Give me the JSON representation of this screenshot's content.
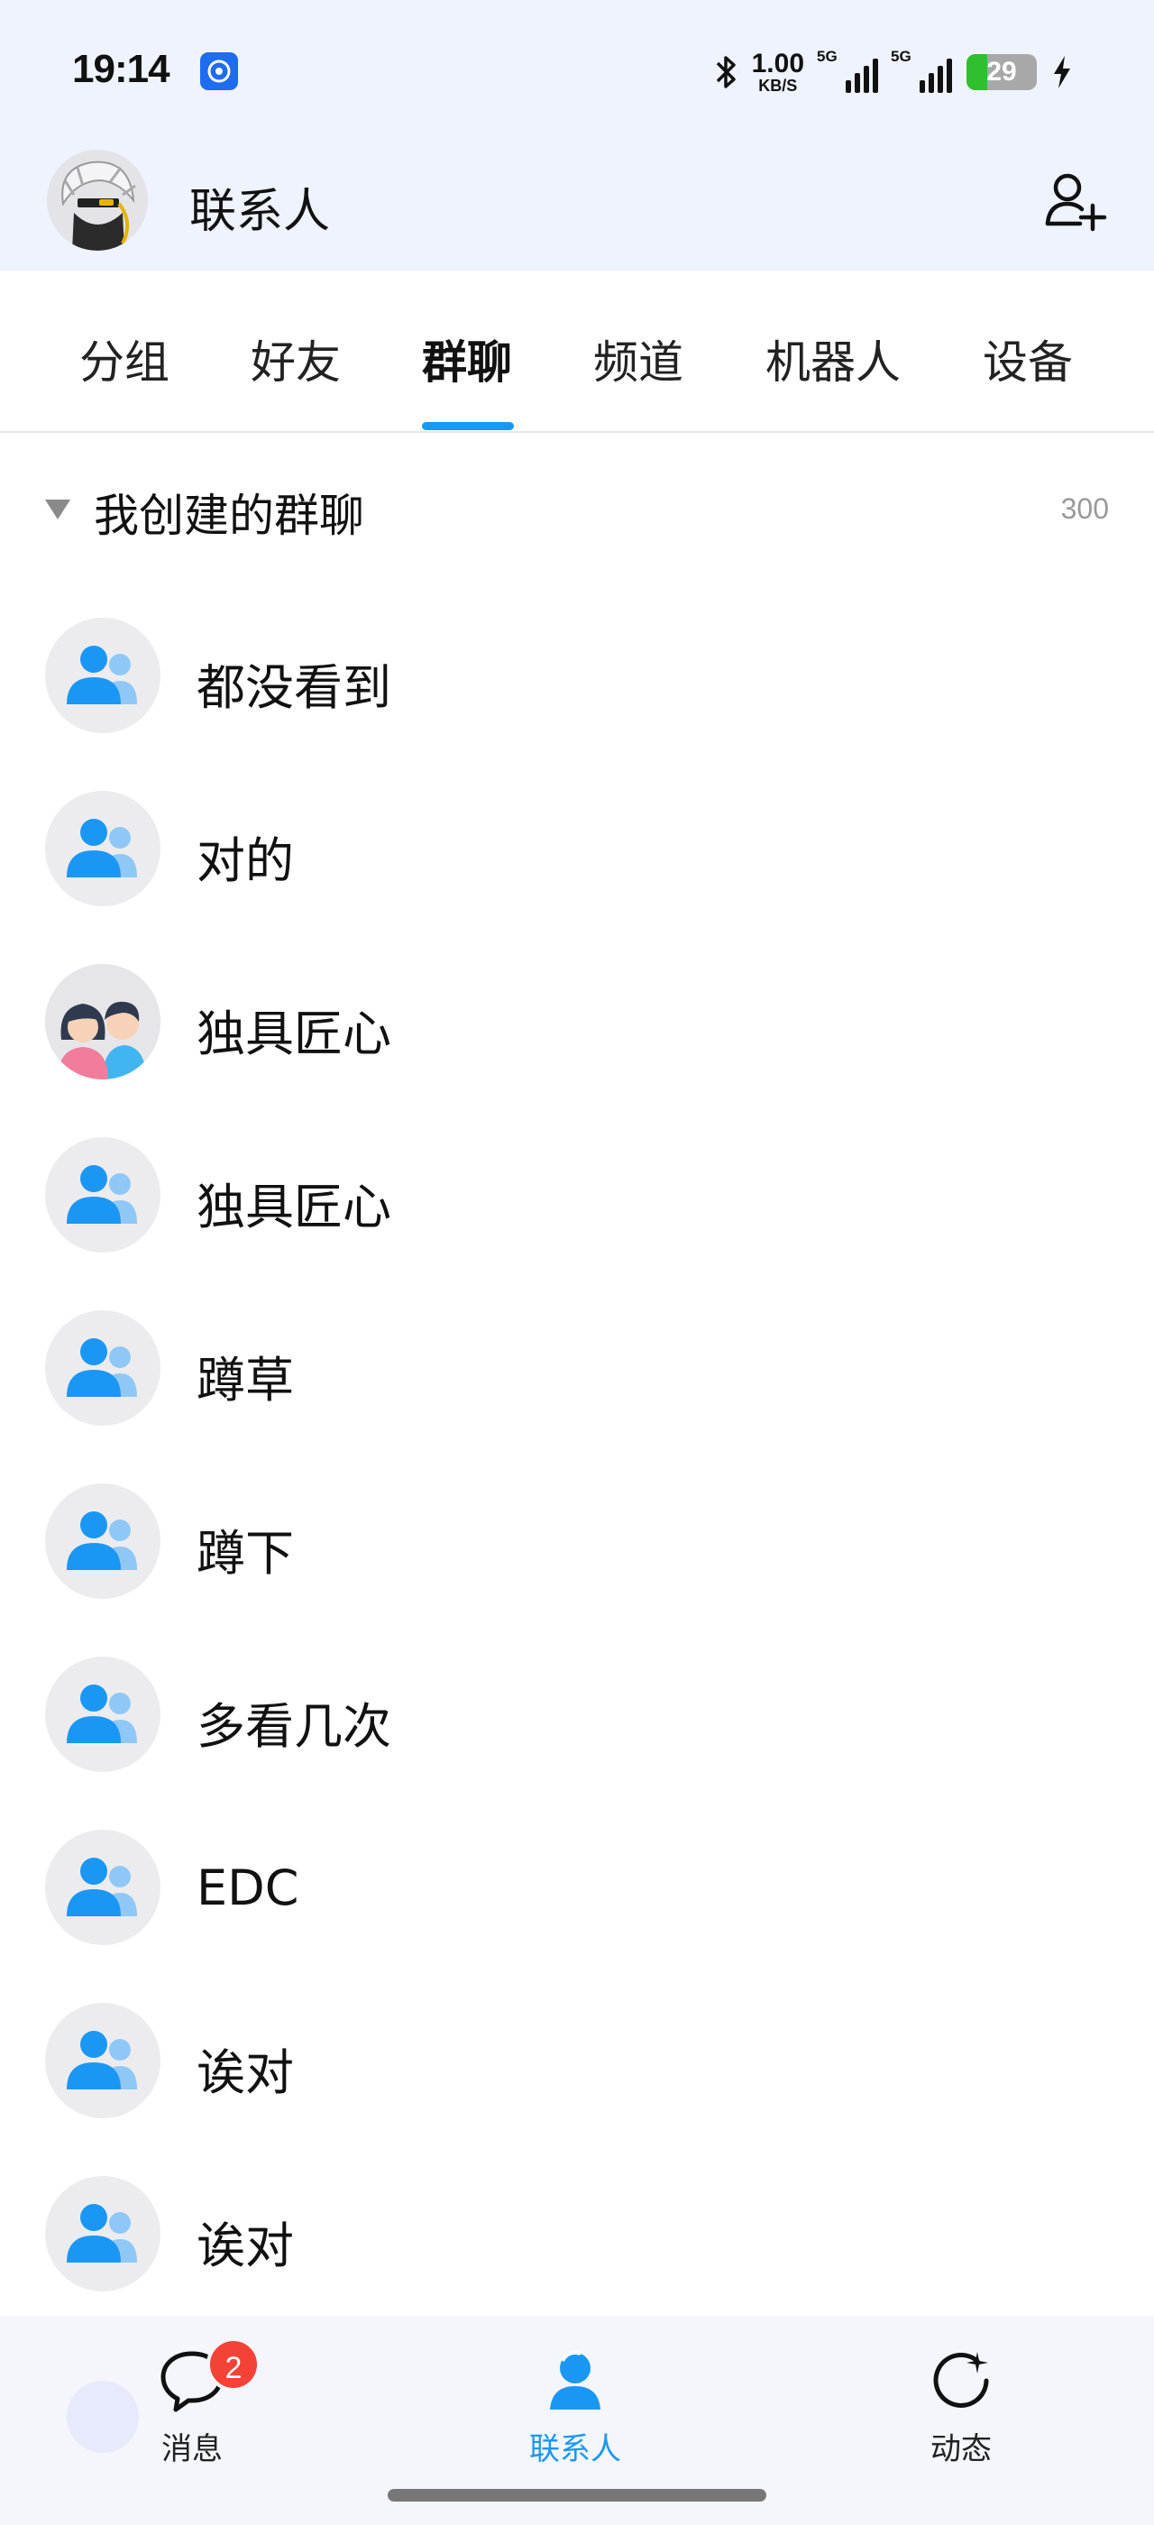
{
  "status_bar": {
    "time": "19:14",
    "net_speed_value": "1.00",
    "net_speed_unit": "KB/S",
    "sim1_tag": "5G",
    "sim2_tag": "5G",
    "battery": "29",
    "battery_level_percent": 29,
    "icons": [
      "bluetooth-icon",
      "signal-icon",
      "charging-icon"
    ]
  },
  "header": {
    "title": "联系人",
    "add_icon": "add-contact-icon"
  },
  "tabs": [
    {
      "label": "分组",
      "active": false
    },
    {
      "label": "好友",
      "active": false
    },
    {
      "label": "群聊",
      "active": true
    },
    {
      "label": "频道",
      "active": false
    },
    {
      "label": "机器人",
      "active": false
    },
    {
      "label": "设备",
      "active": false
    }
  ],
  "section": {
    "title": "我创建的群聊",
    "count": "300"
  },
  "groups": [
    {
      "name": "都没看到",
      "icon": "group-default-icon"
    },
    {
      "name": "对的",
      "icon": "group-default-icon"
    },
    {
      "name": "独具匠心",
      "icon": "couple-avatar-icon"
    },
    {
      "name": "独具匠心",
      "icon": "group-default-icon"
    },
    {
      "name": "蹲草",
      "icon": "group-default-icon"
    },
    {
      "name": "蹲下",
      "icon": "group-default-icon"
    },
    {
      "name": "多看几次",
      "icon": "group-default-icon"
    },
    {
      "name": "EDC",
      "icon": "group-default-icon"
    },
    {
      "name": "诶对",
      "icon": "group-default-icon"
    },
    {
      "name": "诶对",
      "icon": "group-default-icon"
    }
  ],
  "bottom_nav": [
    {
      "label": "消息",
      "icon": "chat-bubble-icon",
      "badge": "2",
      "active": false
    },
    {
      "label": "联系人",
      "icon": "contacts-icon",
      "active": true
    },
    {
      "label": "动态",
      "icon": "moments-icon",
      "active": false
    }
  ],
  "colors": {
    "accent": "#1a97f5",
    "header_bg": "#eef3fd",
    "badge": "#f44336"
  }
}
